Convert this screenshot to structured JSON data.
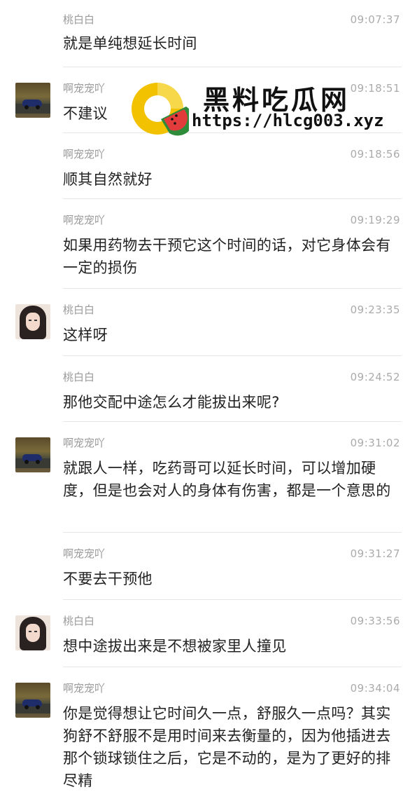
{
  "watermark": {
    "title": "黑料吃瓜网",
    "url": "https://hlcg003.xyz"
  },
  "messages": [
    {
      "name": "桃白白",
      "time": "09:07:37",
      "text": "就是单纯想延长时间",
      "avatar": "none"
    },
    {
      "name": "啊宠宠吖",
      "time": "09:18:51",
      "text": "不建议",
      "avatar": "car-avatar"
    },
    {
      "name": "啊宠宠吖",
      "time": "09:18:56",
      "text": "顺其自然就好",
      "avatar": "none"
    },
    {
      "name": "啊宠宠吖",
      "time": "09:19:29",
      "text": "如果用药物去干预它这个时间的话，对它身体会有一定的损伤",
      "avatar": "none"
    },
    {
      "name": "桃白白",
      "time": "09:23:35",
      "text": "这样呀",
      "avatar": "girl-avatar"
    },
    {
      "name": "桃白白",
      "time": "09:24:52",
      "text": "那他交配中途怎么才能拔出来呢?",
      "avatar": "none"
    },
    {
      "name": "啊宠宠吖",
      "time": "09:31:02",
      "text": "就跟人一样，吃药哥可以延长时间，可以增加硬度，但是也会对人的身体有伤害，都是一个意思的",
      "avatar": "car-avatar"
    },
    {
      "name": "啊宠宠吖",
      "time": "09:31:27",
      "text": "不要去干预他",
      "avatar": "none"
    },
    {
      "name": "桃白白",
      "time": "09:33:56",
      "text": "想中途拔出来是不想被家里人撞见",
      "avatar": "girl-avatar"
    },
    {
      "name": "啊宠宠吖",
      "time": "09:34:04",
      "text": "你是觉得想让它时间久一点，舒服久一点吗？其实狗舒不舒服不是用时间来去衡量的，因为他插进去那个锁球锁住之后，它是不动的，是为了更好的排尽精",
      "avatar": "car-avatar"
    }
  ]
}
